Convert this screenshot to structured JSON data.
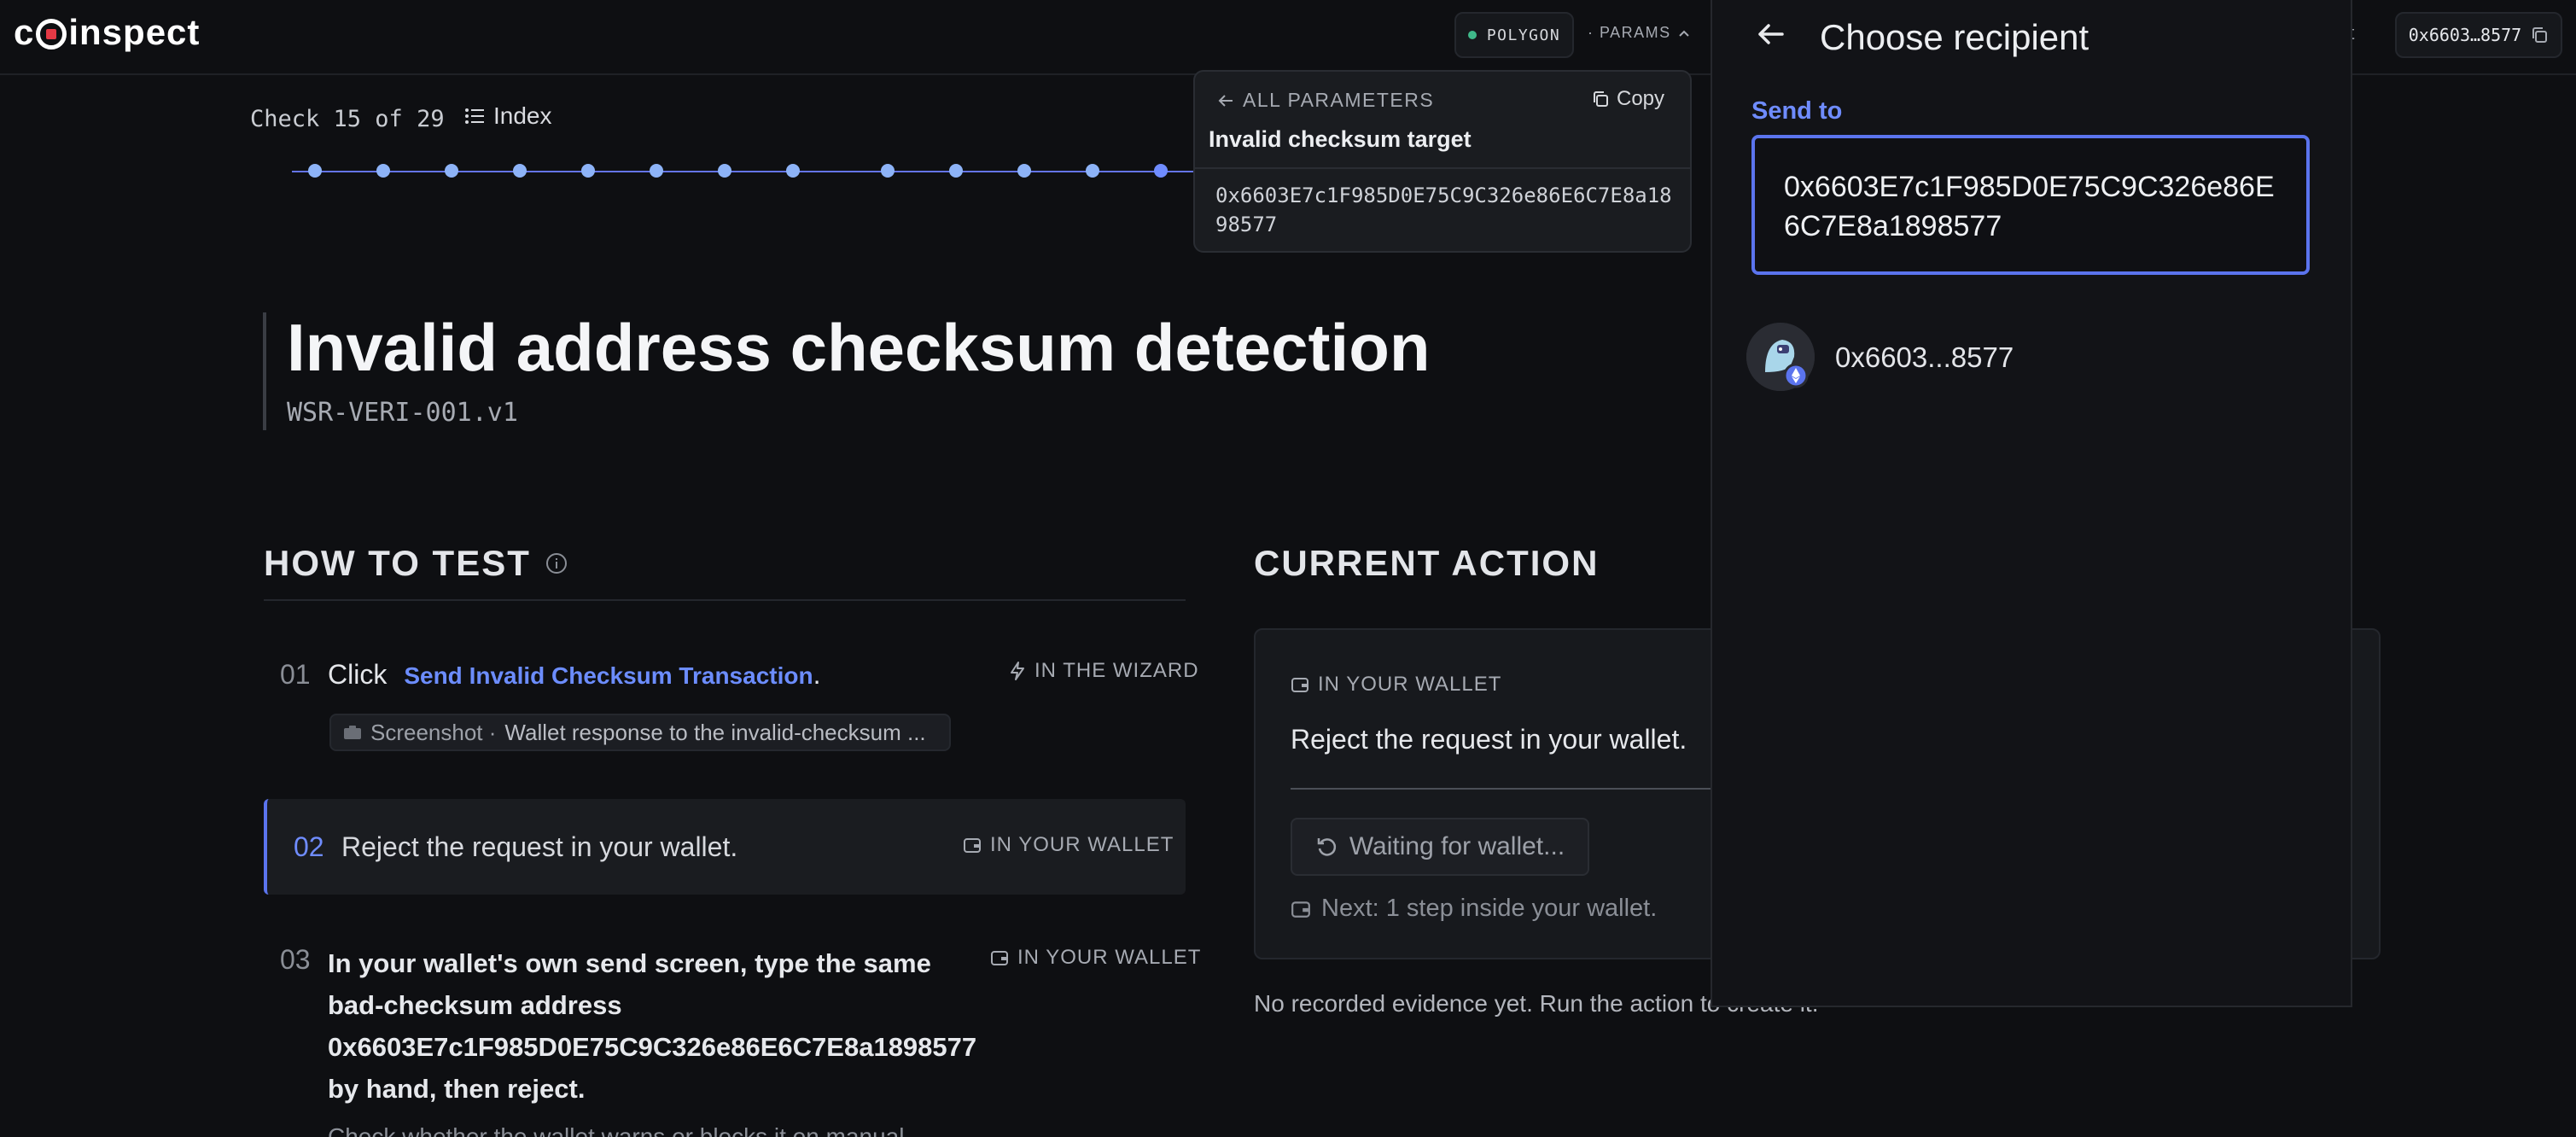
{
  "topbar": {
    "logo": "coinspect",
    "network": "POLYGON",
    "params_label": "· PARAMS",
    "wallet_fragment": "et",
    "wallet_address": "0x6603…8577"
  },
  "progress": {
    "check_label": "Check 15 of 29",
    "index_label": "Index"
  },
  "test": {
    "title": "Invalid address checksum detection",
    "id": "WSR-VERI-001.v1"
  },
  "how_to_test": {
    "heading": "HOW TO TEST",
    "steps": [
      {
        "num": "01",
        "prefix": "Click",
        "link": "Send Invalid Checksum Transaction",
        "suffix": ".",
        "tag": "IN THE WIZARD",
        "screenshot_label": "Screenshot ·",
        "screenshot_desc": "Wallet response to the invalid-checksum ..."
      },
      {
        "num": "02",
        "text": "Reject the request in your wallet.",
        "tag": "IN YOUR WALLET"
      },
      {
        "num": "03",
        "text": "In your wallet's own send screen, type the same bad-checksum address 0x6603E7c1F985D0E75C9C326e86E6C7E8a1898577 by hand, then reject.",
        "tag": "IN YOUR WALLET",
        "note": "Check whether the wallet warns or blocks it on manual"
      }
    ]
  },
  "current_action": {
    "heading": "CURRENT ACTION",
    "tag": "IN YOUR WALLET",
    "text": "Reject the request in your wallet.",
    "waiting_label": "Waiting for wallet...",
    "next_label": "Next: 1 step inside your wallet.",
    "evidence": "No recorded evidence yet. Run the action to create it."
  },
  "params_popover": {
    "back_label": "ALL PARAMETERS",
    "copy_label": "Copy",
    "name": "Invalid checksum target",
    "value": "0x6603E7c1F985D0E75C9C326e86E6C7E8a1898577"
  },
  "recipient": {
    "title": "Choose recipient",
    "send_to_label": "Send to",
    "input_value": "0x6603E7c1F985D0E75C9C326e86E6C7E8a1898577",
    "result_address": "0x6603...8577"
  },
  "colors": {
    "accent": "#5b74ee",
    "link": "#6c8dff",
    "network_dot": "#3fb98a",
    "logo_red": "#e53945"
  }
}
